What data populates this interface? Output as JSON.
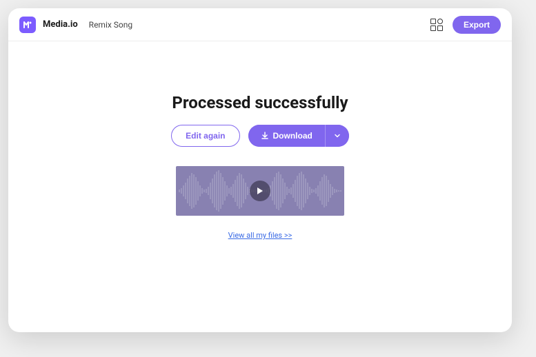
{
  "header": {
    "brand": "Media.io",
    "page_name": "Remix Song",
    "export_label": "Export"
  },
  "main": {
    "title": "Processed successfully",
    "edit_label": "Edit again",
    "download_label": "Download",
    "view_link": "View all my files >>"
  }
}
